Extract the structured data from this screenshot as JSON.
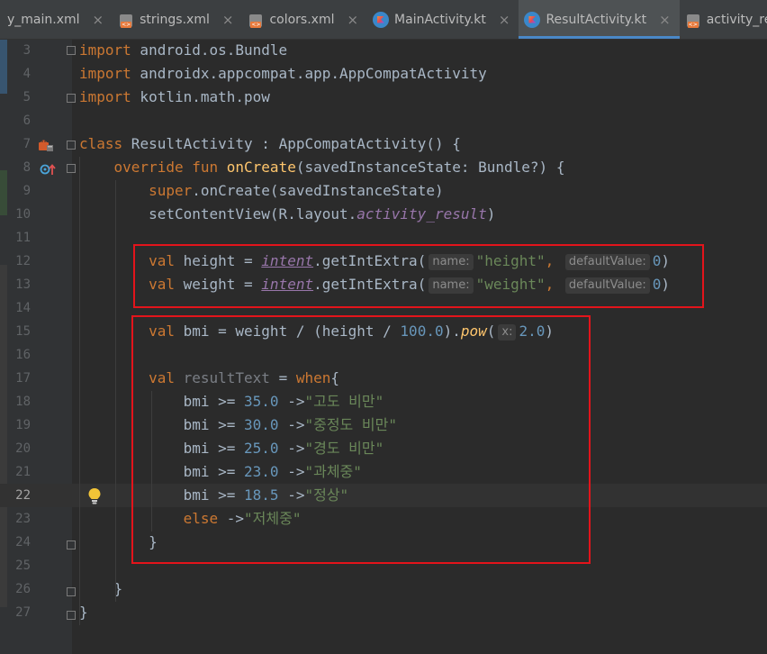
{
  "tabs": [
    {
      "label": "y_main.xml",
      "icon": "xml-file-icon",
      "active": false
    },
    {
      "label": "strings.xml",
      "icon": "xml-file-icon",
      "active": false
    },
    {
      "label": "colors.xml",
      "icon": "xml-file-icon",
      "active": false
    },
    {
      "label": "MainActivity.kt",
      "icon": "kotlin-file-icon",
      "active": false
    },
    {
      "label": "ResultActivity.kt",
      "icon": "kotlin-file-icon",
      "active": true
    },
    {
      "label": "activity_result.xm",
      "icon": "xml-file-icon",
      "active": false
    }
  ],
  "tab_close_glyph": "×",
  "current_line": 22,
  "lines": [
    {
      "n": "3",
      "parts": [
        [
          "kw",
          "import"
        ],
        [
          "p",
          " android.os.Bundle"
        ]
      ]
    },
    {
      "n": "4",
      "parts": [
        [
          "kw",
          "import"
        ],
        [
          "p",
          " androidx.appcompat.app.AppCompatActivity"
        ]
      ]
    },
    {
      "n": "5",
      "parts": [
        [
          "kw",
          "import"
        ],
        [
          "p",
          " kotlin.math.pow"
        ]
      ]
    },
    {
      "n": "6",
      "parts": []
    },
    {
      "n": "7",
      "parts": [
        [
          "kw",
          "class"
        ],
        [
          "p",
          " ResultActivity : AppCompatActivity() {"
        ]
      ]
    },
    {
      "n": "8",
      "parts": [
        [
          "p",
          "    "
        ],
        [
          "kw",
          "override fun "
        ],
        [
          "fn",
          "onCreate"
        ],
        [
          "p",
          "(savedInstanceState: Bundle?) {"
        ]
      ]
    },
    {
      "n": "9",
      "parts": [
        [
          "p",
          "        "
        ],
        [
          "kw",
          "super"
        ],
        [
          "p",
          ".onCreate(savedInstanceState)"
        ]
      ]
    },
    {
      "n": "10",
      "parts": [
        [
          "p",
          "        setContentView(R.layout."
        ],
        [
          "ital",
          "activity_result"
        ],
        [
          "p",
          ")"
        ]
      ]
    },
    {
      "n": "11",
      "parts": []
    },
    {
      "n": "12",
      "parts": [
        [
          "p",
          "        "
        ],
        [
          "kw",
          "val"
        ],
        [
          "p",
          " height = "
        ],
        [
          "field",
          "intent"
        ],
        [
          "p",
          ".getIntExtra("
        ],
        [
          "hint",
          "name:"
        ],
        [
          "str",
          "\"height\""
        ],
        [
          "kw",
          ", "
        ],
        [
          "hint",
          "defaultValue:"
        ],
        [
          "num",
          "0"
        ],
        [
          "p",
          ")"
        ]
      ]
    },
    {
      "n": "13",
      "parts": [
        [
          "p",
          "        "
        ],
        [
          "kw",
          "val"
        ],
        [
          "p",
          " weight = "
        ],
        [
          "field",
          "intent"
        ],
        [
          "p",
          ".getIntExtra("
        ],
        [
          "hint",
          "name:"
        ],
        [
          "str",
          "\"weight\""
        ],
        [
          "kw",
          ", "
        ],
        [
          "hint",
          "defaultValue:"
        ],
        [
          "num",
          "0"
        ],
        [
          "p",
          ")"
        ]
      ]
    },
    {
      "n": "14",
      "parts": []
    },
    {
      "n": "15",
      "parts": [
        [
          "p",
          "        "
        ],
        [
          "kw",
          "val"
        ],
        [
          "p",
          " bmi = weight / (height / "
        ],
        [
          "num",
          "100.0"
        ],
        [
          "p",
          ")."
        ],
        [
          "pow",
          "pow"
        ],
        [
          "p",
          "("
        ],
        [
          "hint",
          "x:"
        ],
        [
          "num",
          "2.0"
        ],
        [
          "p",
          ")"
        ]
      ]
    },
    {
      "n": "16",
      "parts": []
    },
    {
      "n": "17",
      "parts": [
        [
          "p",
          "        "
        ],
        [
          "kw",
          "val"
        ],
        [
          "p",
          " "
        ],
        [
          "unused",
          "resultText"
        ],
        [
          "p",
          " = "
        ],
        [
          "kw",
          "when"
        ],
        [
          "p",
          "{"
        ]
      ]
    },
    {
      "n": "18",
      "parts": [
        [
          "p",
          "            bmi >= "
        ],
        [
          "num",
          "35.0"
        ],
        [
          "p",
          " ->"
        ],
        [
          "str",
          "\"고도 비만\""
        ]
      ]
    },
    {
      "n": "19",
      "parts": [
        [
          "p",
          "            bmi >= "
        ],
        [
          "num",
          "30.0"
        ],
        [
          "p",
          " ->"
        ],
        [
          "str",
          "\"중정도 비만\""
        ]
      ]
    },
    {
      "n": "20",
      "parts": [
        [
          "p",
          "            bmi >= "
        ],
        [
          "num",
          "25.0"
        ],
        [
          "p",
          " ->"
        ],
        [
          "str",
          "\"경도 비만\""
        ]
      ]
    },
    {
      "n": "21",
      "parts": [
        [
          "p",
          "            bmi >= "
        ],
        [
          "num",
          "23.0"
        ],
        [
          "p",
          " ->"
        ],
        [
          "str",
          "\"과체중\""
        ]
      ]
    },
    {
      "n": "22",
      "parts": [
        [
          "p",
          "            bmi >= "
        ],
        [
          "num",
          "18.5"
        ],
        [
          "p",
          " ->"
        ],
        [
          "str",
          "\"정상\""
        ]
      ]
    },
    {
      "n": "23",
      "parts": [
        [
          "p",
          "            "
        ],
        [
          "kw",
          "else"
        ],
        [
          "p",
          " ->"
        ],
        [
          "str",
          "\"저체중\""
        ]
      ]
    },
    {
      "n": "24",
      "parts": [
        [
          "p",
          "        }"
        ]
      ]
    },
    {
      "n": "25",
      "parts": []
    },
    {
      "n": "26",
      "parts": [
        [
          "p",
          "    }"
        ]
      ]
    },
    {
      "n": "27",
      "parts": [
        [
          "p",
          "}"
        ]
      ]
    }
  ],
  "colors": {
    "highlight_box": "#e3141b",
    "keyword": "#cc7832",
    "string": "#6a8759",
    "number": "#6897bb",
    "function": "#ffc66d",
    "property": "#9876aa"
  },
  "gutter_icons": {
    "line_7": "android-class-icon",
    "line_8": "override-method-icon",
    "line_22": "lightbulb-icon"
  }
}
